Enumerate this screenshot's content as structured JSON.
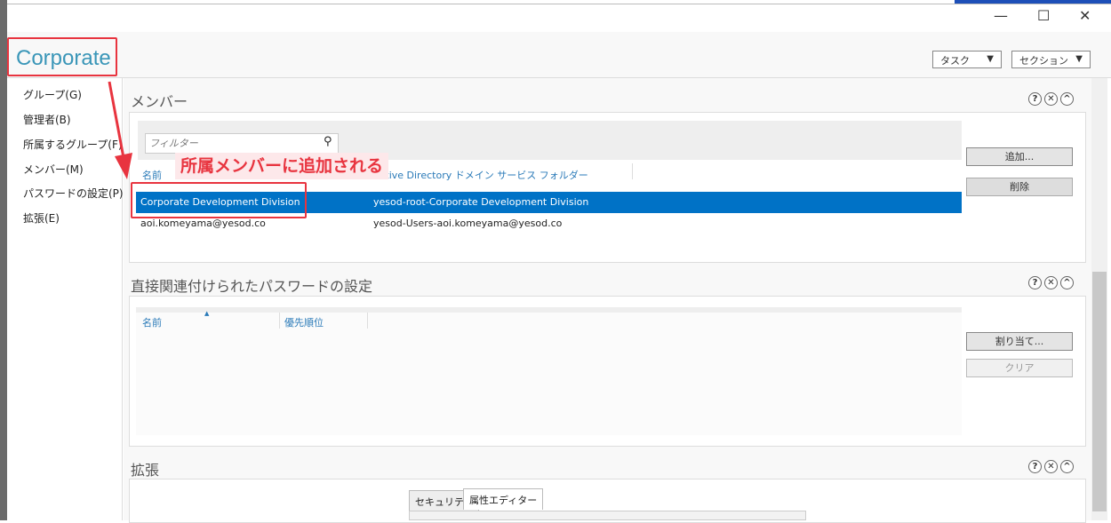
{
  "window": {
    "title": "Corporate",
    "minimize": "—",
    "maximize": "☐",
    "close": "✕"
  },
  "toolbar": {
    "tasks": "タスク",
    "sections": "セクション",
    "dropdown_glyph": "▼"
  },
  "nav": {
    "items": [
      "グループ(G)",
      "管理者(B)",
      "所属するグループ(F)",
      "メンバー(M)",
      "パスワードの設定(P)",
      "拡張(E)"
    ]
  },
  "members": {
    "title": "メンバー",
    "filter_placeholder": "フィルター",
    "columns": [
      "名前",
      "Active Directory ドメイン サービス フォルダー"
    ],
    "rows": [
      {
        "name": "Corporate Development Division",
        "folder": "yesod-root-Corporate Development Division",
        "selected": true
      },
      {
        "name": "aoi.komeyama@yesod.co",
        "folder": "yesod-Users-aoi.komeyama@yesod.co",
        "selected": false
      }
    ],
    "add": "追加...",
    "remove": "削除"
  },
  "password": {
    "title": "直接関連付けられたパスワードの設定",
    "columns": [
      "名前",
      "優先順位"
    ],
    "assign": "割り当て...",
    "clear": "クリア",
    "sort_glyph": "▲"
  },
  "extension": {
    "title": "拡張",
    "tabs": [
      "セキュリティ",
      "属性エディター"
    ]
  },
  "section_icons": {
    "help": "?",
    "close": "✕",
    "collapse": "^"
  },
  "annotation": {
    "callout": "所属メンバーに追加される",
    "color": "#e8343f"
  }
}
